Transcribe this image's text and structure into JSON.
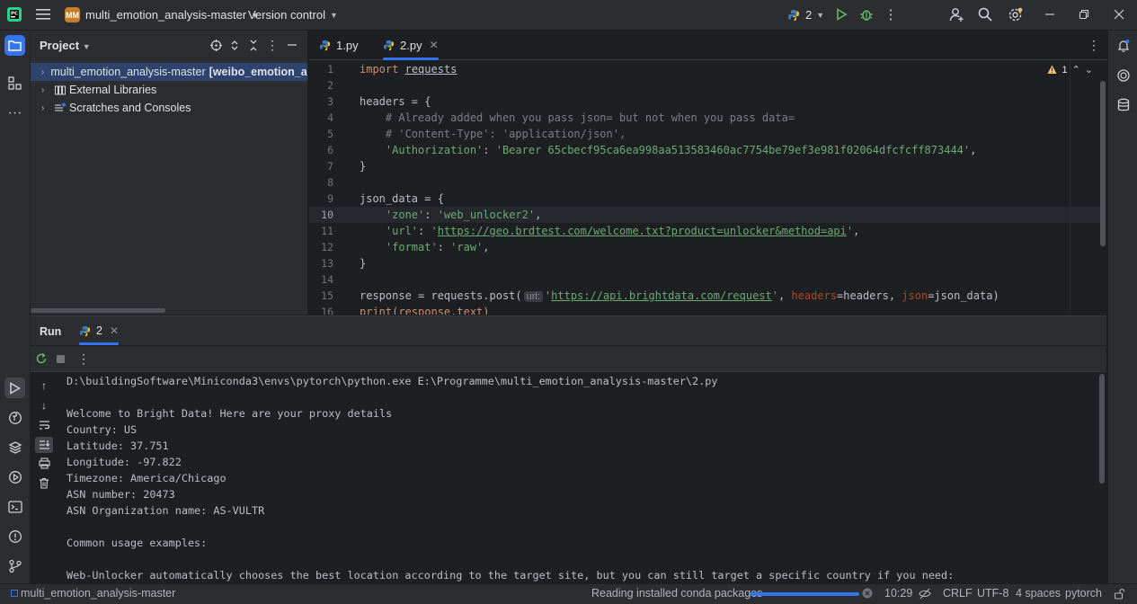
{
  "titlebar": {
    "project_badge": "MM",
    "project_name": "multi_emotion_analysis-master",
    "vcs": "Version control",
    "run_config": "2"
  },
  "project_panel": {
    "title": "Project",
    "tree": [
      {
        "label": "multi_emotion_analysis-master",
        "bold_suffix": "[weibo_emotion_analysis]"
      },
      {
        "label": "External Libraries"
      },
      {
        "label": "Scratches and Consoles"
      }
    ]
  },
  "editor": {
    "tabs": [
      {
        "label": "1.py"
      },
      {
        "label": "2.py"
      }
    ],
    "warning_count": "1",
    "line_numbers": [
      "1",
      "2",
      "3",
      "4",
      "5",
      "6",
      "7",
      "8",
      "9",
      "10",
      "11",
      "12",
      "13",
      "14",
      "15",
      "16"
    ],
    "lines": {
      "l1_kw": "import",
      "l1_mod": "requests",
      "l3": "headers = {",
      "l4": "    # Already added when you pass json= but not when you pass data=",
      "l5": "    # 'Content-Type': 'application/json',",
      "l6_key": "'Authorization'",
      "l6_val": "'Bearer 65cbecf95ca6ea998aa513583460ac7754be79ef3e981f02064dfcfcff873444'",
      "l7": "}",
      "l9": "json_data = {",
      "l10_key": "'zone'",
      "l10_val": "'web_unlocker2'",
      "l11_key": "'url'",
      "l11_url": "https://geo.brdtest.com/welcome.txt?product=unlocker&method=api",
      "l12_key": "'format'",
      "l12_val": "'raw'",
      "l13": "}",
      "l15_pre": "response = requests.post(",
      "l15_hint": "url:",
      "l15_url": "https://api.brightdata.com/request",
      "l15_p1": "headers",
      "l15_v1": "=headers, ",
      "l15_p2": "json",
      "l15_v2": "=json_data)",
      "l16": "print(response.text)"
    }
  },
  "run_panel": {
    "title": "Run",
    "tab": "2",
    "console": [
      "D:\\buildingSoftware\\Miniconda3\\envs\\pytorch\\python.exe E:\\Programme\\multi_emotion_analysis-master\\2.py",
      "",
      "Welcome to Bright Data! Here are your proxy details",
      "Country: US",
      "Latitude: 37.751",
      "Longitude: -97.822",
      "Timezone: America/Chicago",
      "ASN number: 20473",
      "ASN Organization name: AS-VULTR",
      "",
      "Common usage examples:",
      "",
      "Web-Unlocker automatically chooses the best location according to the target site, but you can still target a specific country if you need:"
    ]
  },
  "statusbar": {
    "project": "multi_emotion_analysis-master",
    "task": "Reading installed conda packages",
    "progress": 1.0,
    "position": "10:29",
    "line_sep": "CRLF",
    "encoding": "UTF-8",
    "indent": "4 spaces",
    "interpreter": "pytorch"
  },
  "colors": {
    "accent": "#3574f0",
    "background": "#1e1f22",
    "panel": "#2b2d30",
    "string": "#6aab73",
    "keyword": "#cf8e6d"
  }
}
